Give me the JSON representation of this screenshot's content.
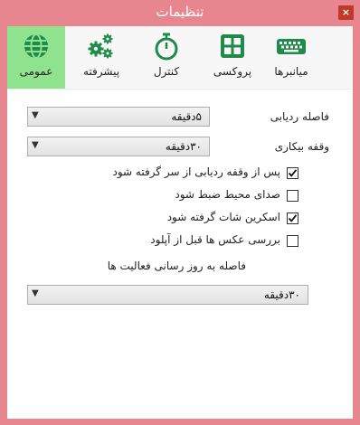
{
  "window": {
    "title": "تنظیمات",
    "close_glyph": "×"
  },
  "toolbar": {
    "tabs": [
      {
        "key": "general",
        "label": "عمومی",
        "icon": "globe-icon"
      },
      {
        "key": "advanced",
        "label": "پیشرفته",
        "icon": "gears-icon"
      },
      {
        "key": "control",
        "label": "کنترل",
        "icon": "stopwatch-icon"
      },
      {
        "key": "proxy",
        "label": "پروکسی",
        "icon": "grid-icon"
      },
      {
        "key": "shortcuts",
        "label": "میانبرها",
        "icon": "keyboard-icon"
      }
    ],
    "active": "general",
    "active_color": "#8fe38f",
    "icon_color": "#1f8a4a"
  },
  "settings": {
    "tracking_interval": {
      "label": "فاصله ردیابی",
      "value": "۵دقیقه"
    },
    "idle_pause": {
      "label": "وقفه بیکاری",
      "value": "۳۰دقیقه"
    },
    "checkboxes": [
      {
        "label": "پس از وقفه ردیابی از سر گرفته شود",
        "checked": true
      },
      {
        "label": "صدای محیط ضبط شود",
        "checked": false
      },
      {
        "label": "اسکرین شات گرفته شود",
        "checked": true
      },
      {
        "label": "بررسی عکس ها قبل از آپلود",
        "checked": false
      }
    ],
    "activity_update": {
      "label": "فاصله به روز رسانی فعالیت ها",
      "value": "۳۰دقیقه"
    }
  }
}
